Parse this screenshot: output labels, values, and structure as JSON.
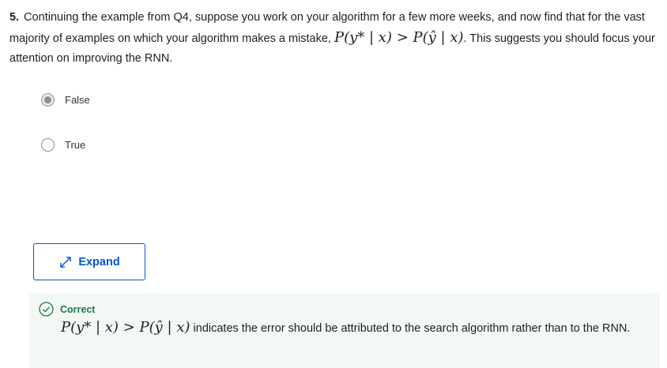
{
  "question": {
    "number": "5.",
    "text_before": "Continuing the example from Q4, suppose you work on your algorithm for a few more weeks, and now find that for the vast majority of examples on which your algorithm makes a mistake, ",
    "math": "P(y* | x) > P(ŷ | x)",
    "text_after": ". This suggests you should focus your attention on improving the RNN."
  },
  "options": [
    {
      "label": "False",
      "selected": true
    },
    {
      "label": "True",
      "selected": false
    }
  ],
  "expand_button": {
    "label": "Expand",
    "icon": "expand-arrows-icon"
  },
  "feedback": {
    "status": "Correct",
    "math": "P(y* | x) > P(ŷ | x)",
    "text": " indicates the error should be attributed to the search algorithm rather than to the RNN.",
    "colors": {
      "success": "#1d7a46",
      "background": "#f4f8f4"
    }
  },
  "colors": {
    "accent": "#0056d2"
  }
}
